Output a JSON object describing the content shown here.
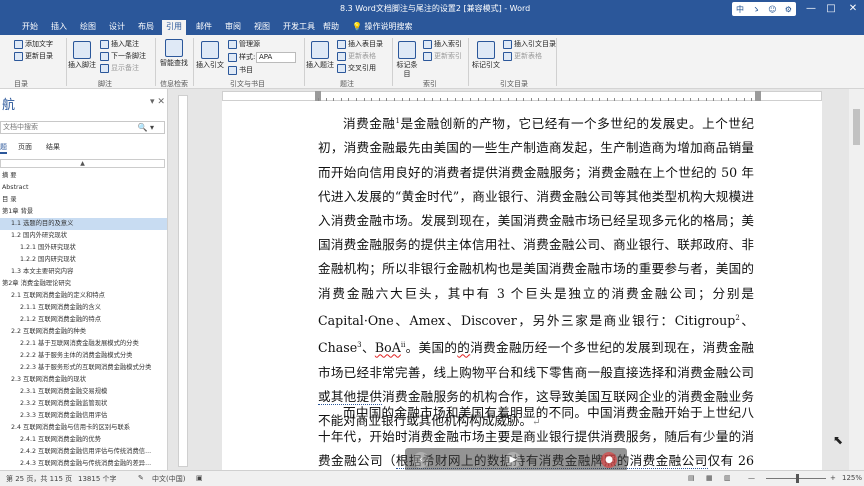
{
  "window": {
    "title": "8.3 Word文档脚注与尾注的设置2 [兼容模式] - Word",
    "ime": [
      "中",
      "ゝ",
      "☺",
      "⚙"
    ],
    "controls": [
      "—",
      "□",
      "✕"
    ]
  },
  "tabs": [
    "开始",
    "插入",
    "绘图",
    "设计",
    "布局",
    "引用",
    "邮件",
    "审阅",
    "视图",
    "开发工具",
    "帮助"
  ],
  "active_tab": "引用",
  "tell_me": "操作说明搜索",
  "ribbon": {
    "toc": {
      "items": [
        "添加文字",
        "更新目录"
      ],
      "group": "目录"
    },
    "footnotes": {
      "big": "插入脚注",
      "items": [
        "插入尾注",
        "下一条脚注",
        "显示备注"
      ],
      "group": "脚注"
    },
    "research": {
      "big": "智能查找",
      "group": "信息检索"
    },
    "citations": {
      "big": "插入引文",
      "items": [
        "管理源",
        "样式:",
        "书目"
      ],
      "style_value": "APA",
      "group": "引文与书目"
    },
    "captions": {
      "big": "插入题注",
      "items": [
        "插入表目录",
        "更新表格",
        "交叉引用"
      ],
      "group": "题注"
    },
    "index": {
      "big": "标记条目",
      "items": [
        "插入索引",
        "更新索引"
      ],
      "group": "索引"
    },
    "toa": {
      "big": "标记引文",
      "items": [
        "插入引文目录",
        "更新表格"
      ],
      "group": "引文目录"
    }
  },
  "nav": {
    "title": "航",
    "search_placeholder": "文档中搜索",
    "tabs": [
      "题",
      "页面",
      "结果"
    ],
    "collapse": "▲",
    "items": [
      {
        "text": "摘 要",
        "indent": 0
      },
      {
        "text": "Abstract",
        "indent": 0
      },
      {
        "text": "目 录",
        "indent": 0
      },
      {
        "text": "第1章 背景",
        "indent": 0
      },
      {
        "text": "1.1 选题的目的及意义",
        "indent": 1,
        "selected": true
      },
      {
        "text": "1.2 国内外研究现状",
        "indent": 1
      },
      {
        "text": "1.2.1 国外研究现状",
        "indent": 2
      },
      {
        "text": "1.2.2 国内研究现状",
        "indent": 2
      },
      {
        "text": "1.3 本文主要研究内容",
        "indent": 1
      },
      {
        "text": "第2章 消费金融理论研究",
        "indent": 0
      },
      {
        "text": "2.1 互联网消费金融的定义和特点",
        "indent": 1
      },
      {
        "text": "2.1.1 互联网消费金融的含义",
        "indent": 2
      },
      {
        "text": "2.1.2 互联网消费金融的特点",
        "indent": 2
      },
      {
        "text": "2.2 互联网消费金融的种类",
        "indent": 1
      },
      {
        "text": "2.2.1 基于互联网消费金融发展模式的分类",
        "indent": 2
      },
      {
        "text": "2.2.2 基于服务主体的消费金融模式分类",
        "indent": 2
      },
      {
        "text": "2.2.3 基于服务形式的互联网消费金融模式分类",
        "indent": 2
      },
      {
        "text": "2.3 互联网消费金融的现状",
        "indent": 1
      },
      {
        "text": "2.3.1 互联网消费金融交易规模",
        "indent": 2
      },
      {
        "text": "2.3.2 互联网消费金融监管现状",
        "indent": 2
      },
      {
        "text": "2.3.3 互联网消费金融信用评估",
        "indent": 2
      },
      {
        "text": "2.4 互联网消费金融与信用卡的区别与联系",
        "indent": 1
      },
      {
        "text": "2.4.1 互联网消费金融的优势",
        "indent": 2
      },
      {
        "text": "2.4.2 互联网消费金融信用评估与传统消费信...",
        "indent": 2
      },
      {
        "text": "2.4.3 互联网消费金融与传统消费金融的差异...",
        "indent": 2
      }
    ]
  },
  "document": {
    "p1": {
      "a": "消费金融",
      "fn1": "1",
      "b": "是金融创新的产物，它已经有一个多世纪的发展史。上个世纪初，消费金融最先由美国的一些生产制造商发起，生产制造商为增加商品销量而开始向信用良好的消费者提供消费金融服务；消费金融在上个世纪的 50 年代进入发展的“黄金时代”，商业银行、消费金融公司等其他类型机构大规模进入消费金融市场。发展到现在，美国消费金融市场已经呈现多元化的格局；美国消费金融服务的提供主体信用社、消费金融公司、商业银行、联邦政府、非金融机构；所以非银行金融机构也是美国消费金融市场的重要参与者，美国的消费金融六大巨头，其中有 3 个巨头是独立的消费金融公司；分别是 Capital·One、Amex、Discover，另外三家是商业银行：Citigroup",
      "fn2": "2",
      "c": "、Chase",
      "fn3": "3",
      "d": "、",
      "boa": "BoA",
      "fn4": "ii",
      "e": "。美国的",
      "de": "的",
      "f": "消费金融历经一个多世纪的发展到现在，消费金融市场已经非常完善，线上购物平台和线下零售商一般直接选择和消费金融公司",
      "g": "或其他提供",
      "h": "消费金融服务的机构合作，这导致美国互联网企业的消费金融业务不能对商业银行或其他机构构成威胁。",
      "ret": "↵"
    },
    "p2": {
      "a": "而中国的金融市场和美国有着明显的不同。中国消费金融开始于上世纪八十年代，开始时消费金融市场主要是商业银行提供消费服务，随后有少量的消费金融公司（",
      "b": "根据希财网上的数据持有消费金融牌照的消费金融公司",
      "c": "仅有 26 家）进"
    }
  },
  "status": {
    "page": "第 25 页，共 115 页",
    "words": "13815 个字",
    "lang": "中文(中国)",
    "zoom": "125%"
  }
}
